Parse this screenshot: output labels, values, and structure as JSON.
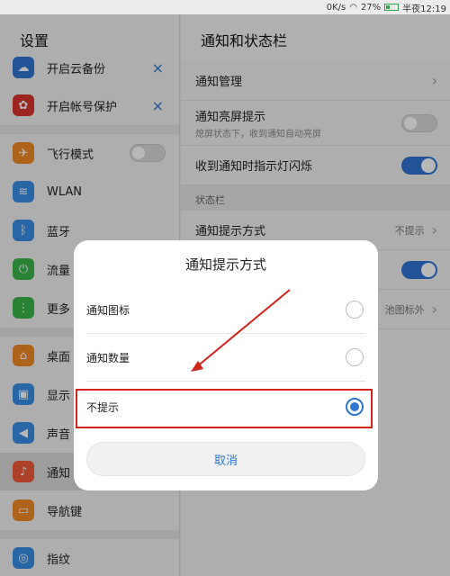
{
  "status_bar": {
    "speed": "0K/s",
    "battery_pct": "27%",
    "time": "半夜12:19",
    "wifi_icon": "wifi-icon",
    "battery_icon": "battery-icon"
  },
  "left_pane": {
    "title": "设置",
    "items": [
      {
        "label": "开启云备份",
        "icon": "cloud-backup-icon",
        "color": "#2f74d0",
        "action": "×"
      },
      {
        "label": "开启帐号保护",
        "icon": "huawei-account-icon",
        "color": "#d9342b",
        "action": "×"
      },
      {
        "label": "飞行模式",
        "icon": "airplane-icon",
        "color": "#f08a24"
      },
      {
        "label": "WLAN",
        "icon": "wifi-icon",
        "color": "#3a8ee6"
      },
      {
        "label": "蓝牙",
        "icon": "bluetooth-icon",
        "color": "#3a8ee6"
      },
      {
        "label": "流量",
        "icon": "data-usage-icon",
        "color": "#3bb54a"
      },
      {
        "label": "更多",
        "icon": "more-icon",
        "color": "#3bb54a"
      },
      {
        "label": "桌面",
        "icon": "home-icon",
        "color": "#f08a24"
      },
      {
        "label": "显示",
        "icon": "display-icon",
        "color": "#3a8ee6"
      },
      {
        "label": "声音",
        "icon": "sound-icon",
        "color": "#3a8ee6"
      },
      {
        "label": "通知",
        "icon": "notification-icon",
        "color": "#f05a3a"
      },
      {
        "label": "导航键",
        "icon": "navigation-key-icon",
        "color": "#f08a24"
      },
      {
        "label": "指纹",
        "icon": "fingerprint-icon",
        "color": "#3a8ee6"
      }
    ]
  },
  "right_pane": {
    "title": "通知和状态栏",
    "items": [
      {
        "label": "通知管理"
      },
      {
        "label": "通知亮屏提示",
        "sub": "熄屏状态下，收到通知自动亮屏"
      },
      {
        "label": "收到通知时指示灯闪烁"
      }
    ],
    "section_label": "状态栏",
    "status_items": [
      {
        "label": "通知提示方式",
        "value": "不提示"
      },
      {
        "label": ""
      },
      {
        "label": "",
        "value": "池图标外"
      }
    ]
  },
  "dialog": {
    "title": "通知提示方式",
    "options": [
      {
        "label": "通知图标",
        "selected": false
      },
      {
        "label": "通知数量",
        "selected": false
      },
      {
        "label": "不提示",
        "selected": true
      }
    ],
    "cancel_label": "取消",
    "highlight_color": "#d0231c",
    "accent_color": "#2f74d0"
  }
}
